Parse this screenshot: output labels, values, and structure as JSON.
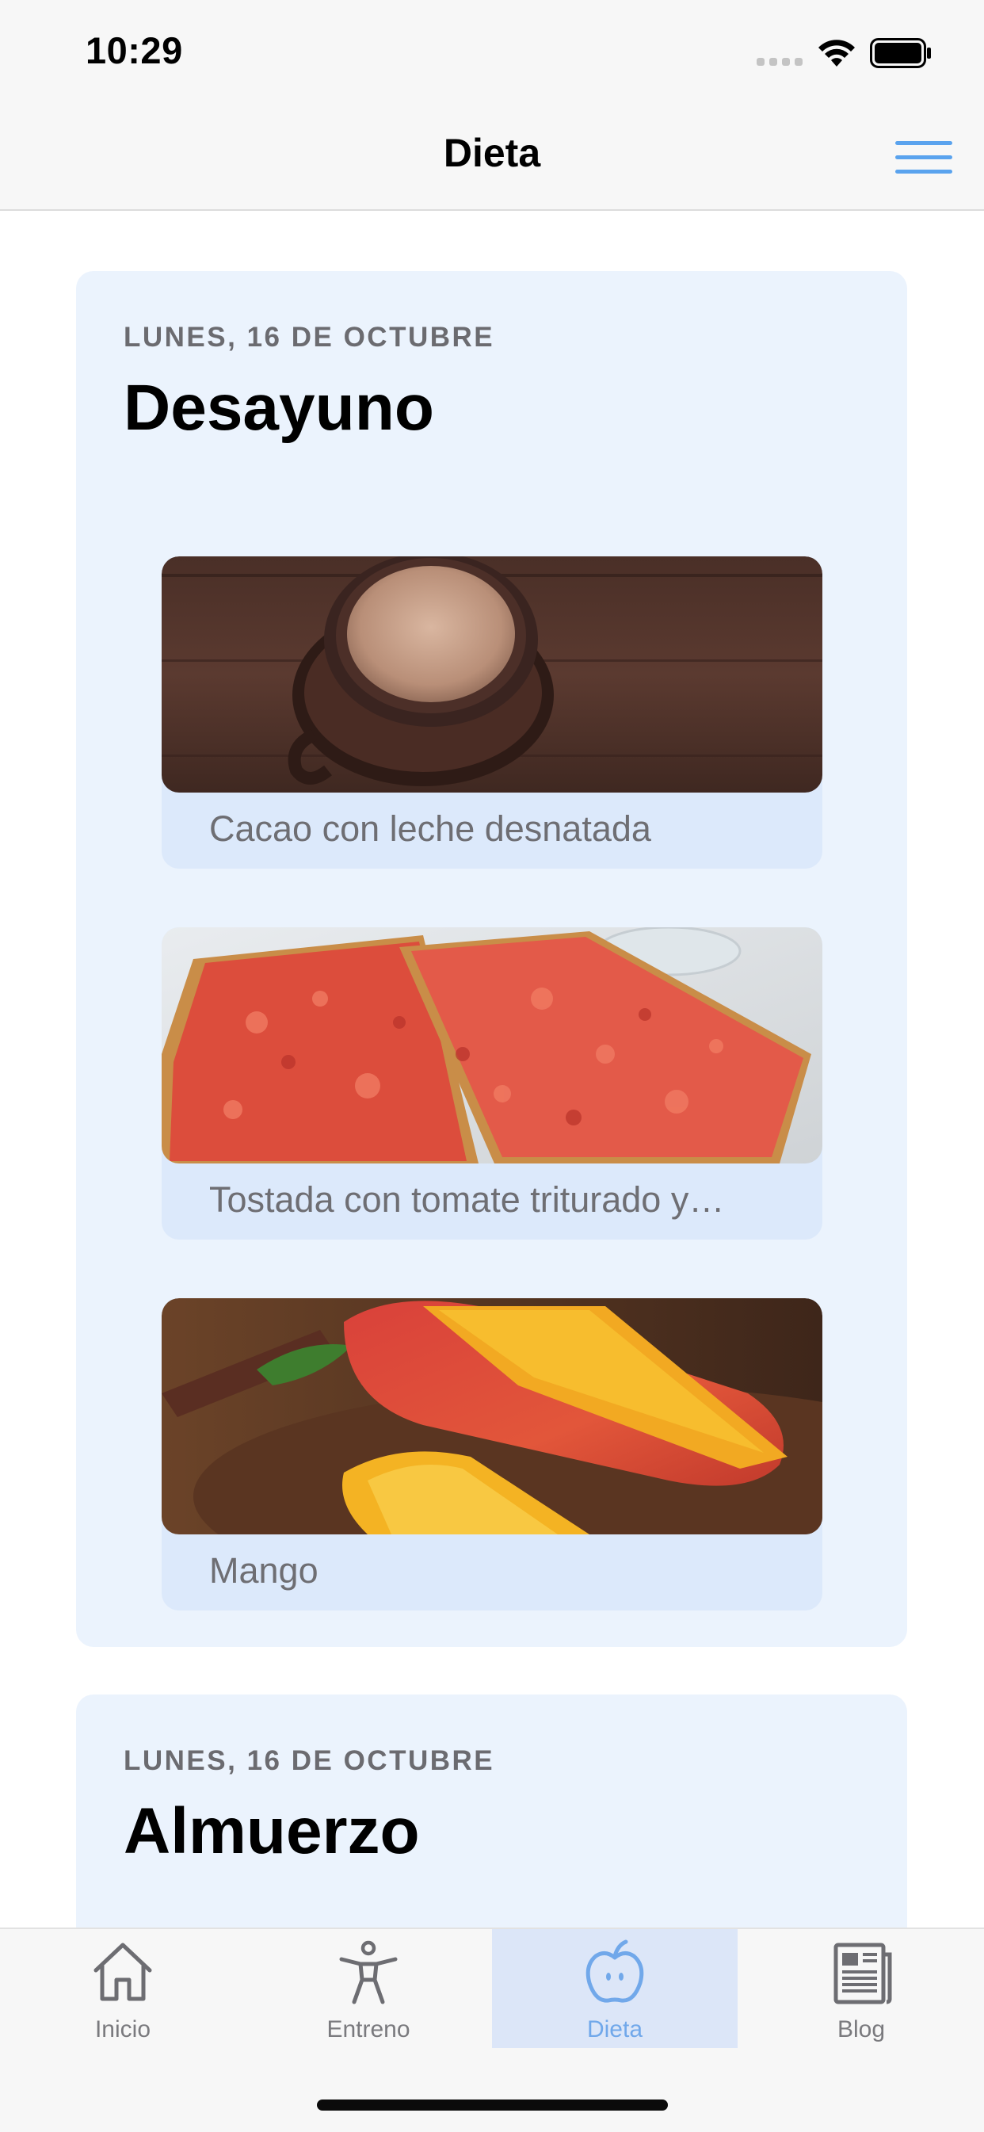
{
  "status_bar": {
    "time": "10:29"
  },
  "nav": {
    "title": "Dieta",
    "menu_icon": "hamburger-menu-icon",
    "accent_color": "#5aa3ee"
  },
  "meals": [
    {
      "date": "LUNES, 16 DE OCTUBRE",
      "title": "Desayuno",
      "items": [
        {
          "label": "Cacao con leche desnatada",
          "image": "cocoa-cup-photo"
        },
        {
          "label": "Tostada con tomate triturado y…",
          "image": "tomato-toast-photo"
        },
        {
          "label": "Mango",
          "image": "mango-photo"
        }
      ]
    },
    {
      "date": "LUNES, 16 DE OCTUBRE",
      "title": "Almuerzo",
      "items": []
    }
  ],
  "tabs": [
    {
      "label": "Inicio",
      "icon": "house-icon",
      "active": false
    },
    {
      "label": "Entreno",
      "icon": "person-figure-icon",
      "active": false
    },
    {
      "label": "Dieta",
      "icon": "apple-icon",
      "active": true
    },
    {
      "label": "Blog",
      "icon": "newspaper-icon",
      "active": false
    }
  ],
  "colors": {
    "card_background": "#ebf3fd",
    "item_background": "#dce9fb",
    "tab_active_background": "#dce6f8",
    "tab_active_color": "#71a8ea"
  }
}
